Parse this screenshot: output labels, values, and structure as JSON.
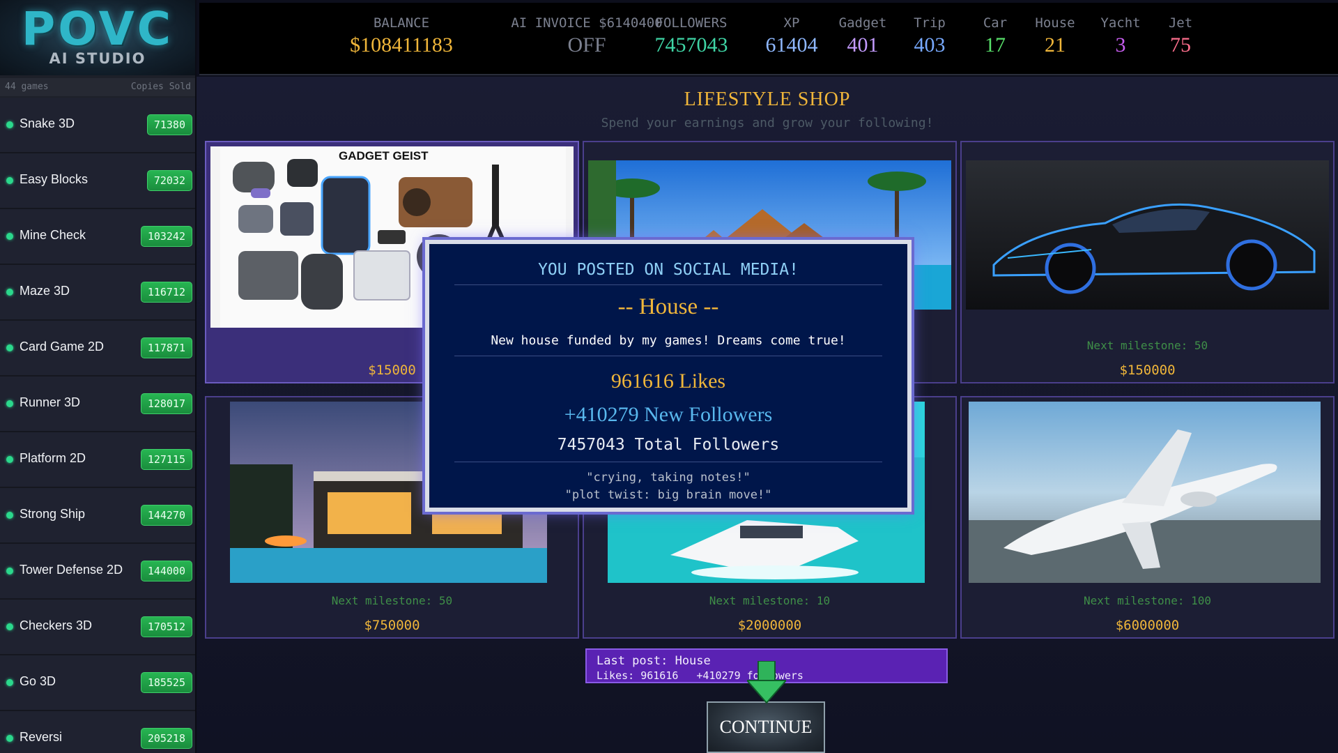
{
  "app": {
    "logo_main": "POVC",
    "logo_sub": "AI STUDIO"
  },
  "sidebar": {
    "games_count": "44 games",
    "column_label": "Copies Sold",
    "games": [
      {
        "name": "Snake 3D",
        "sold": "71380"
      },
      {
        "name": "Easy Blocks",
        "sold": "72032"
      },
      {
        "name": "Mine Check",
        "sold": "103242"
      },
      {
        "name": "Maze 3D",
        "sold": "116712"
      },
      {
        "name": "Card Game 2D",
        "sold": "117871"
      },
      {
        "name": "Runner 3D",
        "sold": "128017"
      },
      {
        "name": "Platform 2D",
        "sold": "127115"
      },
      {
        "name": "Strong Ship",
        "sold": "144270"
      },
      {
        "name": "Tower Defense 2D",
        "sold": "144000"
      },
      {
        "name": "Checkers 3D",
        "sold": "170512"
      },
      {
        "name": "Go 3D",
        "sold": "185525"
      },
      {
        "name": "Reversi",
        "sold": "205218"
      }
    ]
  },
  "stats": [
    {
      "label": "BALANCE",
      "value": "$108411183",
      "color": "#f0b63a"
    },
    {
      "label": "AI INVOICE  $6140400",
      "value": "OFF",
      "color": "#7c8190"
    },
    {
      "label": "FOLLOWERS",
      "value": "7457043",
      "color": "#3fd6a6"
    },
    {
      "label": "XP",
      "value": "61404",
      "color": "#8fb8ff"
    },
    {
      "label": "Gadget",
      "value": "401",
      "color": "#c49bff"
    },
    {
      "label": "Trip",
      "value": "403",
      "color": "#78aaff"
    },
    {
      "label": "Car",
      "value": "17",
      "color": "#58e06a"
    },
    {
      "label": "House",
      "value": "21",
      "color": "#f0b63a"
    },
    {
      "label": "Yacht",
      "value": "3",
      "color": "#c85df0"
    },
    {
      "label": "Jet",
      "value": "75",
      "color": "#ff6f8e"
    }
  ],
  "shop": {
    "title": "LIFESTYLE SHOP",
    "subtitle": "Spend your earnings and grow your following!",
    "items": [
      {
        "name": "Gadget",
        "image_text": "GADGET GEIST",
        "milestone": "",
        "price": "$15000"
      },
      {
        "name": "Trip",
        "image_text": "",
        "milestone": "",
        "price": ""
      },
      {
        "name": "Car",
        "image_text": "",
        "milestone": "Next milestone: 50",
        "price": "$150000"
      },
      {
        "name": "House",
        "image_text": "",
        "milestone": "Next milestone: 50",
        "price": "$750000"
      },
      {
        "name": "Yacht",
        "image_text": "",
        "milestone": "Next milestone: 10",
        "price": "$2000000"
      },
      {
        "name": "Jet",
        "image_text": "",
        "milestone": "Next milestone: 100",
        "price": "$6000000"
      }
    ]
  },
  "last_post": {
    "line1": "Last post: House",
    "likes": "Likes: 961616",
    "followers": "+410279 followers"
  },
  "continue_label": "CONTINUE",
  "popup": {
    "title": "YOU POSTED ON SOCIAL MEDIA!",
    "item": "-- House --",
    "caption": "New house funded by my games! Dreams come true!",
    "likes": "961616  Likes",
    "new_followers": "+410279  New Followers",
    "total_followers": "7457043  Total Followers",
    "comment1": "\"crying, taking notes!\"",
    "comment2": "\"plot twist: big brain move!\""
  }
}
